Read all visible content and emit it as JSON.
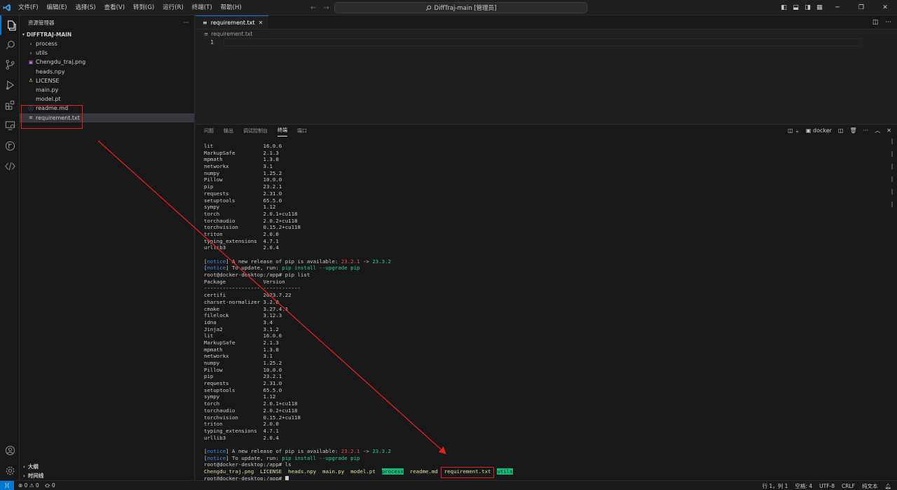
{
  "titlebar": {
    "menu": [
      "文件(F)",
      "编辑(E)",
      "选择(S)",
      "查看(V)",
      "转到(G)",
      "运行(R)",
      "终端(T)",
      "帮助(H)"
    ],
    "search_text": "DiffTraj-main [管理员]"
  },
  "sidebar": {
    "header": "资源管理器",
    "section": "DIFFTRAJ-MAIN",
    "items": [
      {
        "label": "process",
        "type": "folder"
      },
      {
        "label": "utils",
        "type": "folder"
      },
      {
        "label": "Chengdu_traj.png",
        "type": "image"
      },
      {
        "label": "heads.npy",
        "type": "file"
      },
      {
        "label": "LICENSE",
        "type": "license"
      },
      {
        "label": "main.py",
        "type": "file"
      },
      {
        "label": "model.pt",
        "type": "file"
      },
      {
        "label": "readme.md",
        "type": "info"
      },
      {
        "label": "requirement.txt",
        "type": "text"
      }
    ],
    "bottom": [
      "大纲",
      "时间线"
    ]
  },
  "editor": {
    "tab_label": "requirement.txt",
    "breadcrumb": "requirement.txt",
    "line_number": "1"
  },
  "panel": {
    "tabs": [
      "问题",
      "输出",
      "调试控制台",
      "终端",
      "端口"
    ],
    "active_tab": "终端",
    "terminal_name": "docker"
  },
  "terminal": {
    "packages_a": [
      [
        "lit",
        "16.0.6"
      ],
      [
        "MarkupSafe",
        "2.1.3"
      ],
      [
        "mpmath",
        "1.3.0"
      ],
      [
        "networkx",
        "3.1"
      ],
      [
        "numpy",
        "1.25.2"
      ],
      [
        "Pillow",
        "10.0.0"
      ],
      [
        "pip",
        "23.2.1"
      ],
      [
        "requests",
        "2.31.0"
      ],
      [
        "setuptools",
        "65.5.0"
      ],
      [
        "sympy",
        "1.12"
      ],
      [
        "torch",
        "2.0.1+cu118"
      ],
      [
        "torchaudio",
        "2.0.2+cu118"
      ],
      [
        "torchvision",
        "0.15.2+cu118"
      ],
      [
        "triton",
        "2.0.0"
      ],
      [
        "typing_extensions",
        "4.7.1"
      ],
      [
        "urllib3",
        "2.0.4"
      ]
    ],
    "notice_tag": "notice",
    "notice1_text": " A new release of pip is available: ",
    "notice1_old": "23.2.1",
    "notice1_arrow": " -> ",
    "notice1_new": "23.3.2",
    "notice2_text": " To update, run: ",
    "notice2_cmd": "pip install --upgrade pip",
    "prompt_piplist": "root@docker-desktop:/app# pip list",
    "header": [
      "Package",
      "Version"
    ],
    "separator": "------------------ ------------",
    "packages_b": [
      [
        "certifi",
        "2023.7.22"
      ],
      [
        "charset-normalizer",
        "3.2.0"
      ],
      [
        "cmake",
        "3.27.4.1"
      ],
      [
        "filelock",
        "3.12.3"
      ],
      [
        "idna",
        "3.4"
      ],
      [
        "Jinja2",
        "3.1.2"
      ],
      [
        "lit",
        "16.0.6"
      ],
      [
        "MarkupSafe",
        "2.1.3"
      ],
      [
        "mpmath",
        "1.3.0"
      ],
      [
        "networkx",
        "3.1"
      ],
      [
        "numpy",
        "1.25.2"
      ],
      [
        "Pillow",
        "10.0.0"
      ],
      [
        "pip",
        "23.2.1"
      ],
      [
        "requests",
        "2.31.0"
      ],
      [
        "setuptools",
        "65.5.0"
      ],
      [
        "sympy",
        "1.12"
      ],
      [
        "torch",
        "2.0.1+cu118"
      ],
      [
        "torchaudio",
        "2.0.2+cu118"
      ],
      [
        "torchvision",
        "0.15.2+cu118"
      ],
      [
        "triton",
        "2.0.0"
      ],
      [
        "typing_extensions",
        "4.7.1"
      ],
      [
        "urllib3",
        "2.0.4"
      ]
    ],
    "prompt_ls": "root@docker-desktop:/app# ls",
    "ls_output": [
      {
        "name": "Chengdu_traj.png",
        "dir": false
      },
      {
        "name": "LICENSE",
        "dir": false
      },
      {
        "name": "heads.npy",
        "dir": false
      },
      {
        "name": "main.py",
        "dir": false
      },
      {
        "name": "model.pt",
        "dir": false
      },
      {
        "name": "process",
        "dir": true
      },
      {
        "name": "readme.md",
        "dir": false
      },
      {
        "name": "requirement.txt",
        "dir": false
      },
      {
        "name": "utils",
        "dir": true
      }
    ],
    "prompt_final": "root@docker-desktop:/app# "
  },
  "statusbar": {
    "problems": "⊗ 0 ⚠ 0",
    "ports": "⛮ 0",
    "position": "行 1，列 1",
    "spaces": "空格: 4",
    "encoding": "UTF-8",
    "eol": "CRLF",
    "language": "纯文本"
  },
  "colors": {
    "accent": "#0078d4",
    "annotation": "#e02020",
    "dir_highlight": "#0dbc79"
  }
}
